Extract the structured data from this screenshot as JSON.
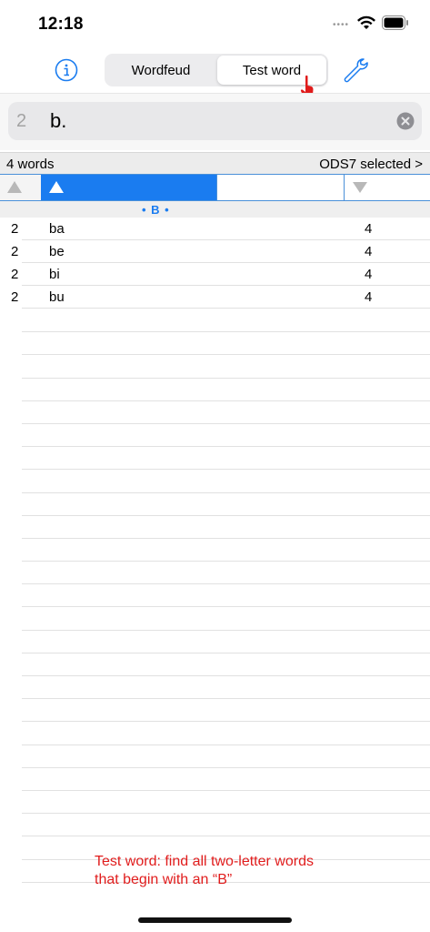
{
  "status": {
    "time": "12:18",
    "dots": "••••"
  },
  "toolbar": {
    "segments": [
      {
        "label": "Wordfeud",
        "selected": false
      },
      {
        "label": "Test word",
        "selected": true
      }
    ]
  },
  "search": {
    "count": "2",
    "value": "b."
  },
  "header": {
    "words_count": "4 words",
    "dictionary": "ODS7 selected >"
  },
  "filter": {
    "label": "• B •"
  },
  "results": [
    {
      "length": "2",
      "word": "ba",
      "score": "4"
    },
    {
      "length": "2",
      "word": "be",
      "score": "4"
    },
    {
      "length": "2",
      "word": "bi",
      "score": "4"
    },
    {
      "length": "2",
      "word": "bu",
      "score": "4"
    }
  ],
  "caption": {
    "line1": "Test word: find all two-letter words",
    "line2": "that begin with an “B”"
  },
  "colors": {
    "accent": "#1a7cf0",
    "caption": "#e11d1d"
  }
}
